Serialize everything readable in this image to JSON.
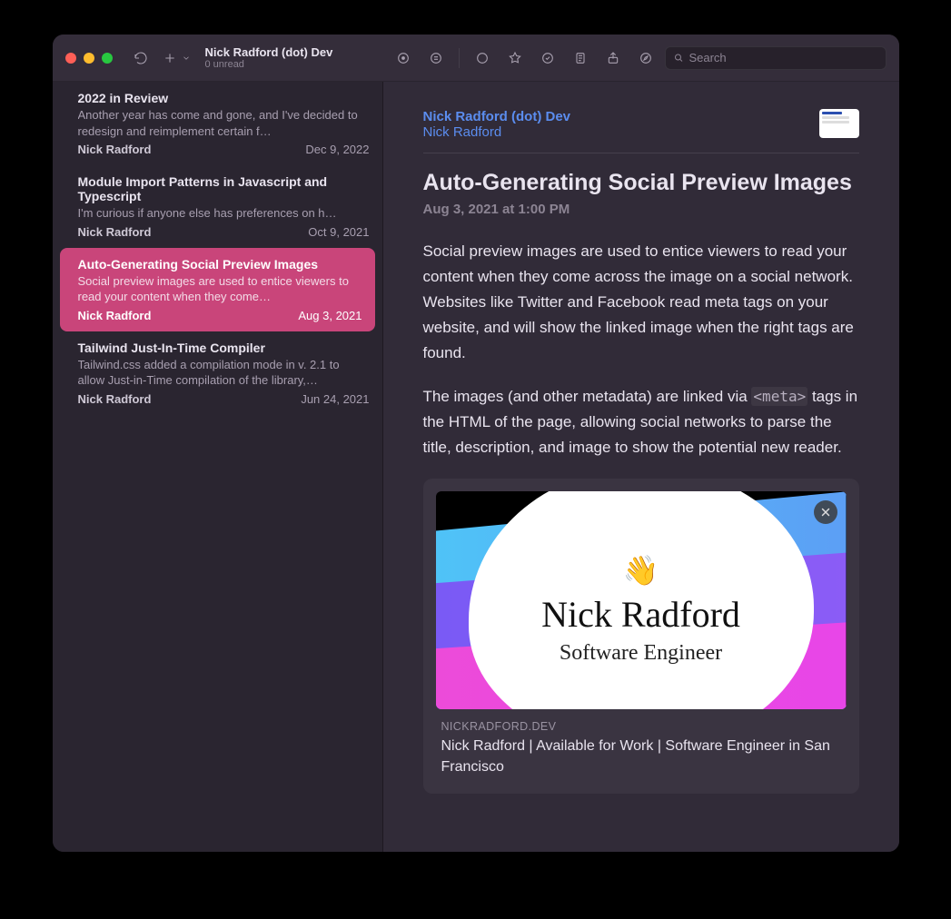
{
  "header": {
    "feed_title": "Nick Radford (dot) Dev",
    "feed_sub": "0 unread",
    "search_placeholder": "Search"
  },
  "sidebar": {
    "items": [
      {
        "title": "2022 in Review",
        "excerpt": "Another year has come and gone, and I've decided to redesign and reimplement certain f…",
        "author": "Nick Radford",
        "date": "Dec 9, 2022",
        "selected": false
      },
      {
        "title": "Module Import Patterns in Javascript and Typescript",
        "excerpt": "I'm curious if anyone else has preferences on h…",
        "author": "Nick Radford",
        "date": "Oct 9, 2021",
        "selected": false
      },
      {
        "title": "Auto-Generating Social Preview Images",
        "excerpt": "Social preview images are used to entice viewers to read your content when they come…",
        "author": "Nick Radford",
        "date": "Aug 3, 2021",
        "selected": true
      },
      {
        "title": "Tailwind Just-In-Time Compiler",
        "excerpt": "Tailwind.css added a compilation mode in v. 2.1 to allow Just-in-Time compilation of the library,…",
        "author": "Nick Radford",
        "date": "Jun 24, 2021",
        "selected": false
      }
    ]
  },
  "article": {
    "feed_link": "Nick Radford (dot) Dev",
    "author_link": "Nick Radford",
    "title": "Auto-Generating Social Preview Images",
    "date": "Aug 3, 2021 at 1:00 PM",
    "p1": "Social preview images are used to entice viewers to read your content when they come across the image on a social network. Websites like Twitter and Facebook read meta tags on your website, and will show the linked image when the right tags are found.",
    "p2_a": "The images (and other metadata) are linked via ",
    "p2_code": "<meta>",
    "p2_b": " tags in the HTML of the page, allowing social networks to parse the title, description, and image to show the potential new reader.",
    "card": {
      "domain": "NICKRADFORD.DEV",
      "title": "Nick Radford | Available for Work | Software Engineer in San Francisco",
      "image_name": "Nick Radford",
      "image_role": "Software Engineer",
      "image_emoji": "👋"
    }
  }
}
